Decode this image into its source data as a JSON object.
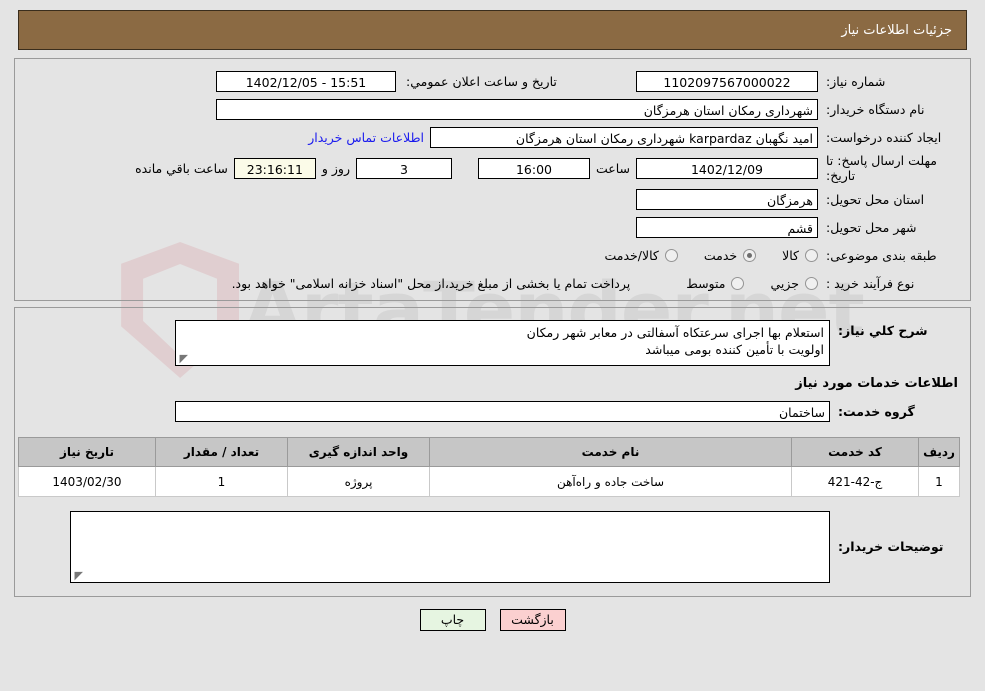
{
  "header": {
    "title": "جزئیات اطلاعات نیاز"
  },
  "watermark": {
    "text": "ArtaTender.net",
    "shield_color": "#d99ea4",
    "text_color": "#b9b9b9"
  },
  "colors": {
    "header_bg": "#8b6a43",
    "panel_border": "#9a9a9a",
    "page_bg": "#e4e4e4",
    "link": "#1a1aee",
    "table_header_bg": "#c6c6c6",
    "back_btn_bg": "#fbd0d0",
    "print_btn_bg": "#e6f5e1",
    "highlight_field_bg": "#fbfbe8"
  },
  "form": {
    "need_number": {
      "label": "شماره نیاز:",
      "value": "1102097567000022"
    },
    "announce_datetime": {
      "label": "تاریخ و ساعت اعلان عمومي:",
      "value": "15:51 - 1402/12/05"
    },
    "buyer_org": {
      "label": "نام دستگاه خریدار:",
      "value": "شهرداری رمکان استان هرمزگان"
    },
    "request_creator": {
      "label": "ایجاد کننده درخواست:",
      "value": "امید نگهبان karpardaz شهرداری رمکان استان هرمزگان"
    },
    "buyer_contact_link": {
      "label": "اطلاعات تماس خریدار"
    },
    "deadline": {
      "label": "مهلت ارسال پاسخ: تا تاریخ:",
      "date_value": "1402/12/09",
      "time_label": "ساعت",
      "time_value": "16:00",
      "days_value": "3",
      "days_label": "روز و",
      "countdown_value": "23:16:11",
      "countdown_label": "ساعت باقي مانده"
    },
    "delivery_province": {
      "label": "استان محل تحویل:",
      "value": "هرمزگان"
    },
    "delivery_city": {
      "label": "شهر محل تحویل:",
      "value": "قشم"
    },
    "subject_category": {
      "label": "طبقه بندی موضوعی:",
      "options": [
        {
          "label": "کالا",
          "selected": false
        },
        {
          "label": "خدمت",
          "selected": true
        },
        {
          "label": "کالا/خدمت",
          "selected": false
        }
      ]
    },
    "purchase_process_type": {
      "label": "نوع فرآیند خرید :",
      "options": [
        {
          "label": "جزیي",
          "selected": false
        },
        {
          "label": "متوسط",
          "selected": false
        }
      ],
      "note": "پرداخت تمام یا بخشی از مبلغ خرید،از محل \"اسناد خزانه اسلامی\" خواهد بود."
    },
    "general_description": {
      "label": "شرح كلي نياز:",
      "lines": [
        "استعلام بها اجرای سرعتكاه آسفالتی در معابر شهر رمکان",
        "اولویت با تأمین کننده بومی میباشد"
      ]
    },
    "services_section_title": "اطلاعات خدمات مورد نیاز",
    "service_group": {
      "label": "گروه خدمت:",
      "value": "ساختمان"
    },
    "buyer_comments": {
      "label": "توضیحات خریدار:",
      "value": ""
    }
  },
  "table": {
    "columns": [
      "ردیف",
      "کد خدمت",
      "نام خدمت",
      "واحد اندازه گیری",
      "تعداد / مقدار",
      "تاریخ نیاز"
    ],
    "rows": [
      {
        "row_no": "1",
        "service_code": "ج-42-421",
        "service_name": "ساخت جاده و راه‌آهن",
        "unit": "پروژه",
        "quantity": "1",
        "need_date": "1403/02/30"
      }
    ]
  },
  "footer": {
    "print_label": "چاپ",
    "back_label": "بازگشت"
  }
}
